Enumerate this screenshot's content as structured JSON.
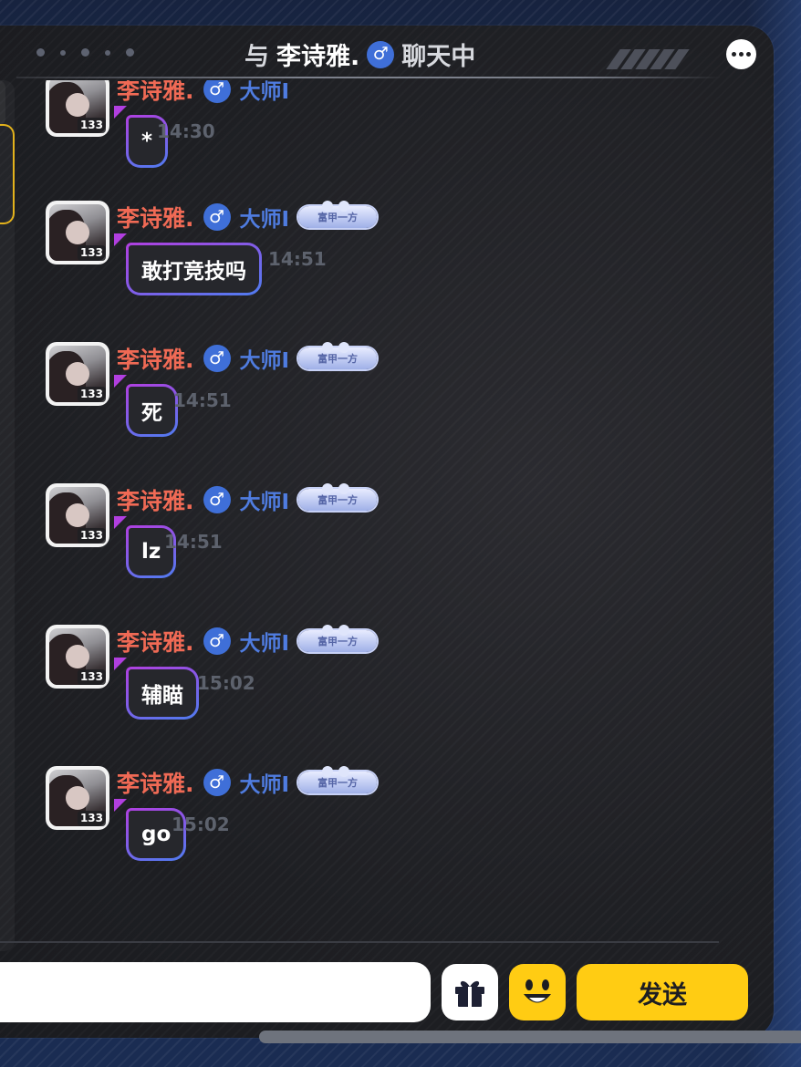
{
  "header": {
    "prefix": "与",
    "partner_name": "李诗雅.",
    "gender_symbol": "♂",
    "status": "聊天中",
    "more_icon": "more-dots-icon"
  },
  "messages": [
    {
      "name": "李诗雅.",
      "gender": "♂",
      "rank": "大师I",
      "badge": "",
      "level": "133",
      "text": "*",
      "time": "14:30"
    },
    {
      "name": "李诗雅.",
      "gender": "♂",
      "rank": "大师I",
      "badge": "富甲一方",
      "level": "133",
      "text": "敢打竞技吗",
      "time": "14:51"
    },
    {
      "name": "李诗雅.",
      "gender": "♂",
      "rank": "大师I",
      "badge": "富甲一方",
      "level": "133",
      "text": "死",
      "time": "14:51"
    },
    {
      "name": "李诗雅.",
      "gender": "♂",
      "rank": "大师I",
      "badge": "富甲一方",
      "level": "133",
      "text": "lz",
      "time": "14:51"
    },
    {
      "name": "李诗雅.",
      "gender": "♂",
      "rank": "大师I",
      "badge": "富甲一方",
      "level": "133",
      "text": "辅瞄",
      "time": "15:02"
    },
    {
      "name": "李诗雅.",
      "gender": "♂",
      "rank": "大师I",
      "badge": "富甲一方",
      "level": "133",
      "text": "go",
      "time": "15:02"
    }
  ],
  "footer": {
    "input_value": "",
    "gift_icon": "gift-icon",
    "emoji_icon": "smiley-face-icon",
    "send_label": "发送"
  },
  "colors": {
    "accent_yellow": "#ffcc13",
    "name_red": "#f06a55",
    "rank_blue": "#4f7ce0",
    "gender_blue": "#3f6fd8",
    "bubble_border_purple": "#b13fe0"
  }
}
